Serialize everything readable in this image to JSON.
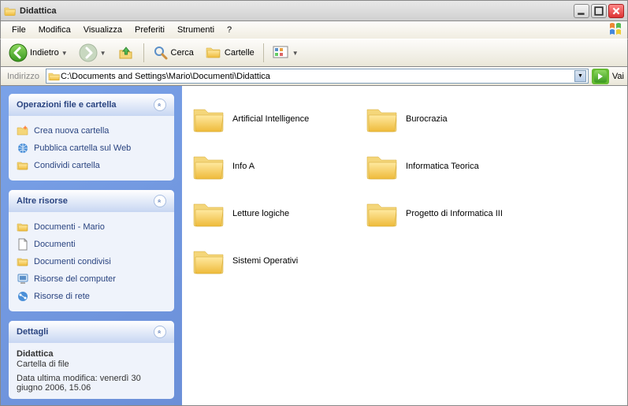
{
  "window": {
    "title": "Didattica"
  },
  "menu": {
    "items": [
      "File",
      "Modifica",
      "Visualizza",
      "Preferiti",
      "Strumenti",
      "?"
    ]
  },
  "toolbar": {
    "back": "Indietro",
    "search": "Cerca",
    "folders": "Cartelle"
  },
  "address": {
    "label": "Indirizzo",
    "path": "C:\\Documents and Settings\\Mario\\Documenti\\Didattica",
    "go": "Vai"
  },
  "sidebar": {
    "panels": [
      {
        "title": "Operazioni file e cartella",
        "tasks": [
          {
            "icon": "new-folder-icon",
            "label": "Crea nuova cartella"
          },
          {
            "icon": "publish-web-icon",
            "label": "Pubblica cartella sul Web"
          },
          {
            "icon": "share-folder-icon",
            "label": "Condividi cartella"
          }
        ]
      },
      {
        "title": "Altre risorse",
        "tasks": [
          {
            "icon": "folder-icon",
            "label": "Documenti - Mario"
          },
          {
            "icon": "document-icon",
            "label": "Documenti"
          },
          {
            "icon": "shared-folder-icon",
            "label": "Documenti condivisi"
          },
          {
            "icon": "computer-icon",
            "label": "Risorse del computer"
          },
          {
            "icon": "network-icon",
            "label": "Risorse di rete"
          }
        ]
      }
    ],
    "details": {
      "title": "Dettagli",
      "name": "Didattica",
      "type": "Cartella di file",
      "modified": "Data ultima modifica: venerdì 30 giugno 2006, 15.06"
    }
  },
  "content": {
    "items": [
      {
        "name": "Artificial Intelligence"
      },
      {
        "name": "Burocrazia"
      },
      {
        "name": "Info A"
      },
      {
        "name": "Informatica Teorica"
      },
      {
        "name": "Letture logiche"
      },
      {
        "name": "Progetto di Informatica III"
      },
      {
        "name": "Sistemi Operativi"
      }
    ]
  }
}
